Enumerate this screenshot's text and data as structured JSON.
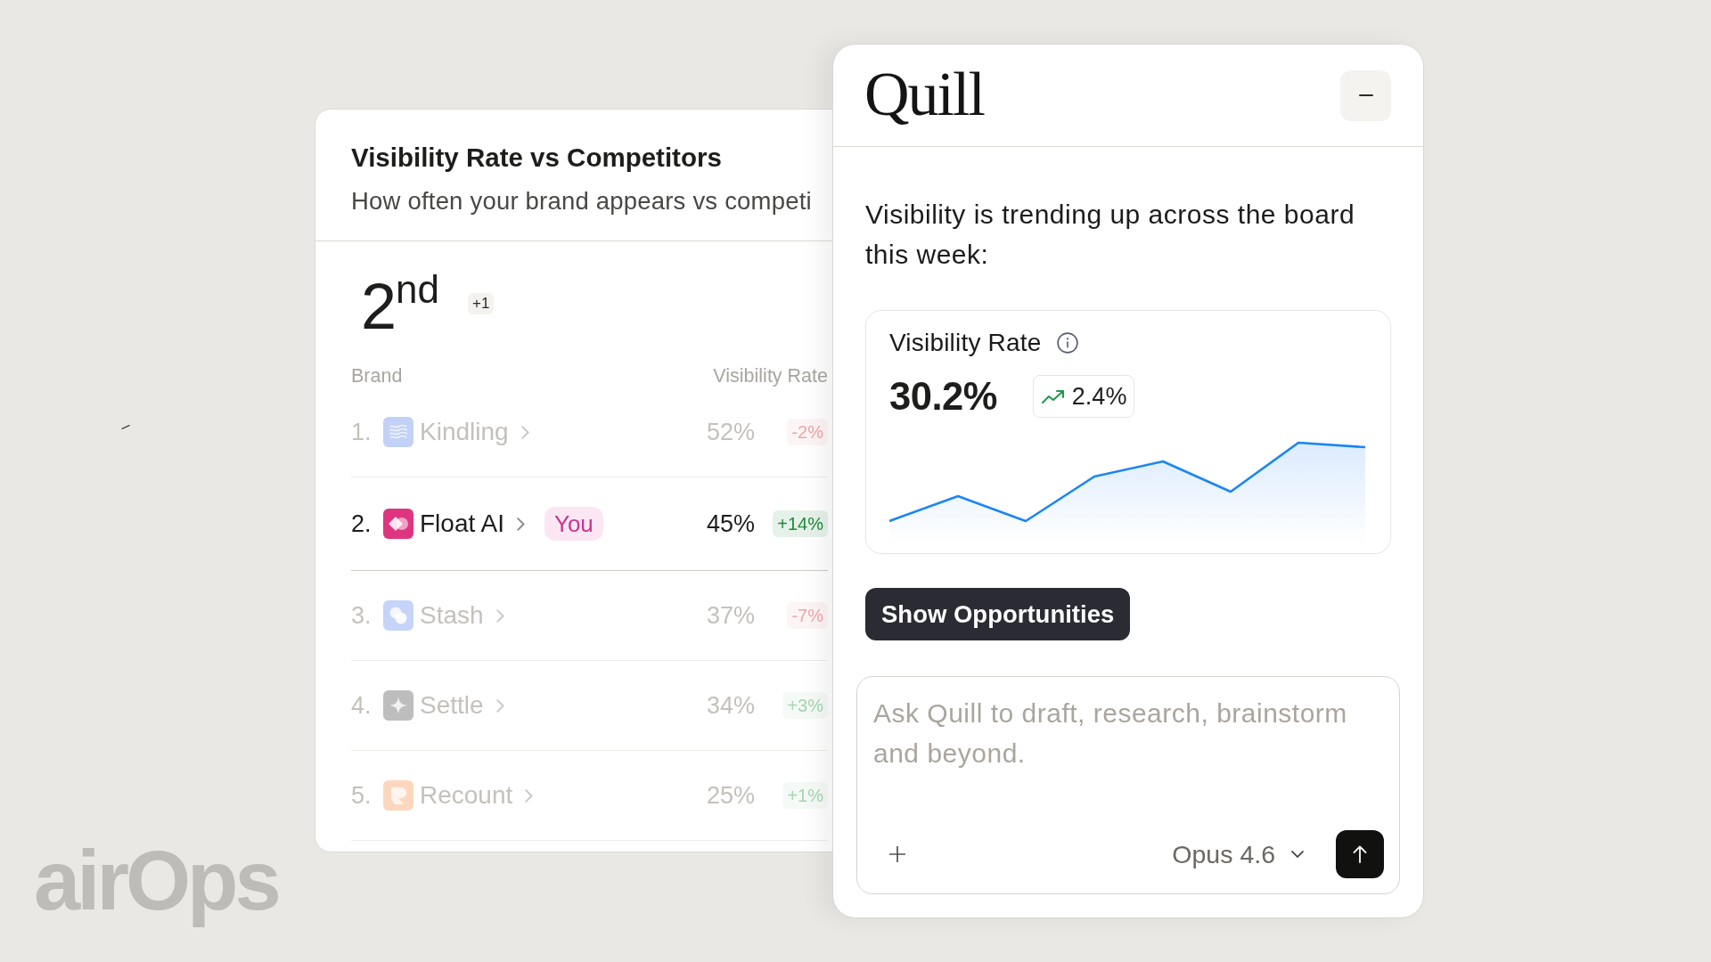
{
  "competitors_card": {
    "title": "Visibility Rate vs Competitors",
    "subtitle": "How often your brand appears vs competi",
    "rank": "2$^{nd}$",
    "rank_change": "+1",
    "columns": [
      "Brand",
      "Visibility Rate"
    ],
    "rows": [
      {
        "rank": "1.",
        "logo": {
          "color": "#c3d1f7"
        },
        "name": "Kindling",
        "value": "52%",
        "change": {
          "text": "-2%",
          "color": "#f0a7a7"
        },
        "selected": false
      },
      {
        "rank": "2.",
        "logo": {
          "color": "#df3580"
        },
        "name": "Float AI",
        "tag": "You",
        "value": "45%",
        "change": {
          "text": "+14%",
          "color": "#1e8a3b"
        },
        "selected": true
      },
      {
        "rank": "3.",
        "logo": {
          "color": "#c6d4fa"
        },
        "name": "Stash",
        "value": "37%",
        "change": {
          "text": "-7%",
          "color": "#f0a7a7"
        },
        "selected": false
      },
      {
        "rank": "4.",
        "logo": {
          "color": "#bdbdbd"
        },
        "name": "Settle",
        "value": "34%",
        "change": {
          "text": "+3%",
          "color": "#a5d6ae"
        },
        "selected": false
      },
      {
        "rank": "5.",
        "logo": {
          "color": "#fdd7bd"
        },
        "name": "Recount",
        "value": "25%",
        "change": {
          "text": "+1%",
          "color": "#a5d6ae"
        },
        "selected": false
      }
    ]
  },
  "assistant": {
    "logo": "Quill",
    "message": "Visibility is trending up across the board this week:",
    "metric": {
      "title": "Visibility Rate",
      "value": "30.2%",
      "change": "2.4%"
    },
    "action": "Show Opportunities",
    "composer": {
      "placeholder": "Ask Quill to draft, research, brainstorm and beyond.",
      "model": "Opus 4.6"
    }
  },
  "brand_logo": "airOps"
}
